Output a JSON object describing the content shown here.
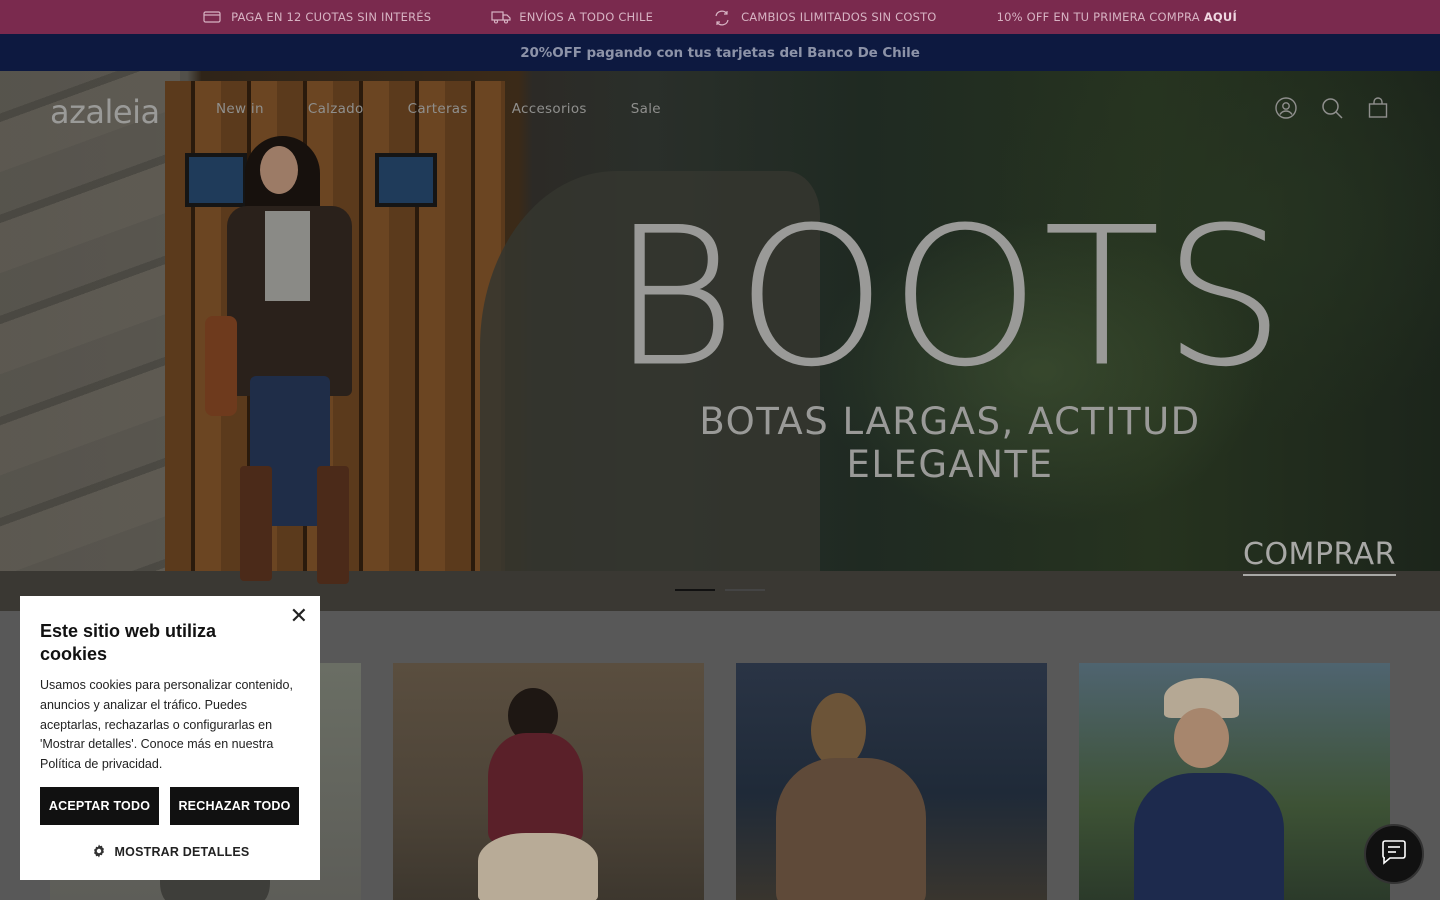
{
  "announcement": {
    "items": [
      {
        "icon": "card-icon",
        "text": "PAGA EN 12 CUOTAS SIN INTERÉS"
      },
      {
        "icon": "truck-icon",
        "text": "ENVÍOS A TODO CHILE"
      },
      {
        "icon": "exchange-icon",
        "text": "CAMBIOS ILIMITADOS SIN COSTO"
      }
    ],
    "offer_text": "10% OFF EN TU PRIMERA COMPRA",
    "offer_link": "AQUÍ",
    "bg_color": "#7a2a4e"
  },
  "promo": {
    "text": "20%OFF pagando con tus tarjetas del Banco De Chile",
    "bg_color": "#0d1940"
  },
  "header": {
    "logo": "azaleia",
    "nav": [
      "New in",
      "Calzado",
      "Carteras",
      "Accesorios",
      "Sale"
    ],
    "icons": [
      "account-icon",
      "search-icon",
      "cart-icon"
    ]
  },
  "hero": {
    "title": "BOOTS",
    "subtitle": "BOTAS LARGAS, ACTITUD ELEGANTE",
    "cta": "COMPRAR",
    "slides_total": 2,
    "slide_active": 1
  },
  "cookie_banner": {
    "title": "Este sitio web utiliza cookies",
    "body": "Usamos cookies para personalizar contenido, anuncios y analizar el tráfico. Puedes aceptarlas, rechazarlas o configurarlas en 'Mostrar detalles'. Conoce más en nuestra Política de privacidad.",
    "accept_label": "ACEPTAR TODO",
    "reject_label": "RECHAZAR TODO",
    "details_label": "MOSTRAR DETALLES",
    "close_icon": "close-icon"
  },
  "chat": {
    "icon": "chat-icon"
  }
}
